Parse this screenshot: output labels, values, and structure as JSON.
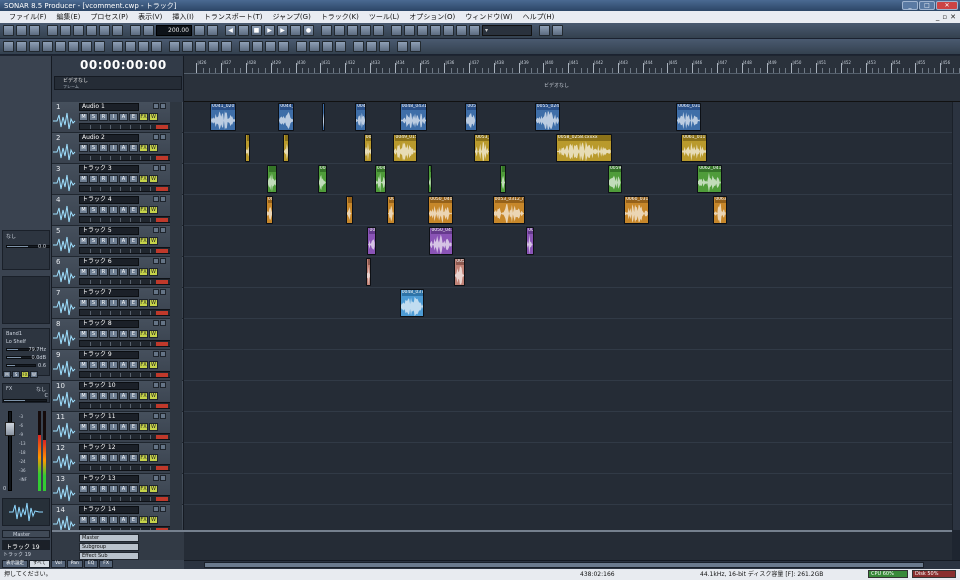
{
  "window": {
    "title": "SONAR 8.5 Producer - [vcomment.cwp - トラック]"
  },
  "menu": [
    "ファイル(F)",
    "編集(E)",
    "プロセス(P)",
    "表示(V)",
    "挿入(I)",
    "トランスポート(T)",
    "ジャンプ(G)",
    "トラック(K)",
    "ツール(L)",
    "オプション(O)",
    "ウィンドウ(W)",
    "ヘルプ(H)"
  ],
  "toolbar": {
    "tempo": "200.00"
  },
  "clock": {
    "time": "00:00:00:00"
  },
  "video": {
    "title": "ビデオなし",
    "fps": "フレーム",
    "cue": "ビデオなし"
  },
  "ruler": {
    "labels": [
      "|426",
      "|427",
      "|428",
      "|429",
      "|430",
      "|431",
      "|432",
      "|433",
      "|434",
      "|435",
      "|436",
      "|437",
      "|438",
      "|439",
      "|440",
      "|441",
      "|442",
      "|443",
      "|444",
      "|445",
      "|446",
      "|447",
      "|448",
      "|449",
      "|450",
      "|451",
      "|452",
      "|453",
      "|454",
      "|455",
      "|456"
    ]
  },
  "inspector": {
    "none_label": "なし",
    "gain": "0.0",
    "eq_band": "Band1",
    "eq_type": "Lo Shelf",
    "freq": "79.7Hz",
    "eq_gain": "0.0dB",
    "q": "0.6",
    "fx": "FX",
    "fx_val": "なし",
    "pan": "C",
    "vol": "0",
    "scale": [
      "-3",
      "-6",
      "-9",
      "-13",
      "-18",
      "-24",
      "-36",
      "-INF"
    ],
    "out": "Master",
    "track": "トラック 19",
    "track_sub": "トラック 19"
  },
  "track_buttons": [
    "M",
    "S",
    "R",
    "I",
    "A",
    "E",
    "FX",
    "W"
  ],
  "tracks": [
    {
      "num": "1",
      "name": "Audio 1"
    },
    {
      "num": "2",
      "name": "Audio 2"
    },
    {
      "num": "3",
      "name": "トラック 3"
    },
    {
      "num": "4",
      "name": "トラック 4"
    },
    {
      "num": "5",
      "name": "トラック 5"
    },
    {
      "num": "6",
      "name": "トラック 6"
    },
    {
      "num": "7",
      "name": "トラック 7"
    },
    {
      "num": "8",
      "name": "トラック 8"
    },
    {
      "num": "9",
      "name": "トラック 9"
    },
    {
      "num": "10",
      "name": "トラック 10"
    },
    {
      "num": "11",
      "name": "トラック 11"
    },
    {
      "num": "12",
      "name": "トラック 12"
    },
    {
      "num": "13",
      "name": "トラック 13"
    },
    {
      "num": "14",
      "name": "トラック 14"
    }
  ],
  "clips": [
    {
      "track": 0,
      "color": "c0",
      "label": "0041_0201.co",
      "start": 426.55,
      "end": 427.6
    },
    {
      "track": 0,
      "color": "c0",
      "label": "0044_02",
      "start": 429.3,
      "end": 429.95
    },
    {
      "track": 0,
      "color": "c0",
      "label": "",
      "start": 431.05,
      "end": 431.15
    },
    {
      "track": 0,
      "color": "c0",
      "label": "0047",
      "start": 432.4,
      "end": 432.85
    },
    {
      "track": 0,
      "color": "c0",
      "label": "0048_0431_c",
      "start": 434.2,
      "end": 435.3
    },
    {
      "track": 0,
      "color": "c0",
      "label": "0052",
      "start": 436.85,
      "end": 437.3
    },
    {
      "track": 0,
      "color": "c0",
      "label": "0055_0248_c",
      "start": 439.65,
      "end": 440.65
    },
    {
      "track": 0,
      "color": "c0",
      "label": "0060_0311_c",
      "start": 445.35,
      "end": 446.35
    },
    {
      "track": 1,
      "color": "c1",
      "label": "",
      "start": 427.95,
      "end": 428.15
    },
    {
      "track": 1,
      "color": "c1",
      "label": "",
      "start": 429.5,
      "end": 429.75
    },
    {
      "track": 1,
      "color": "c1",
      "label": "0048",
      "start": 432.75,
      "end": 433.1
    },
    {
      "track": 1,
      "color": "c1",
      "label": "0049_0158",
      "start": 433.95,
      "end": 434.9
    },
    {
      "track": 1,
      "color": "c1",
      "label": "0053_0",
      "start": 437.2,
      "end": 437.85
    },
    {
      "track": 1,
      "color": "c1",
      "label": "0058_0258.cxxxx",
      "start": 440.5,
      "end": 442.75
    },
    {
      "track": 1,
      "color": "c1",
      "label": "0061_0117_co",
      "start": 445.55,
      "end": 446.6
    },
    {
      "track": 2,
      "color": "c2",
      "label": "",
      "start": 428.85,
      "end": 429.25
    },
    {
      "track": 2,
      "color": "c2",
      "label": "0046",
      "start": 430.9,
      "end": 431.25
    },
    {
      "track": 2,
      "color": "c2",
      "label": "0049",
      "start": 433.2,
      "end": 433.65
    },
    {
      "track": 2,
      "color": "c2",
      "label": "",
      "start": 435.35,
      "end": 435.5
    },
    {
      "track": 2,
      "color": "c2",
      "label": "",
      "start": 438.25,
      "end": 438.5
    },
    {
      "track": 2,
      "color": "c2",
      "label": "0059_0",
      "start": 442.6,
      "end": 443.15
    },
    {
      "track": 2,
      "color": "c2",
      "label": "0062_0412_ro",
      "start": 446.2,
      "end": 447.2
    },
    {
      "track": 3,
      "color": "c3",
      "label": "0043",
      "start": 428.8,
      "end": 429.1
    },
    {
      "track": 3,
      "color": "c3",
      "label": "",
      "start": 432.05,
      "end": 432.3
    },
    {
      "track": 3,
      "color": "c3",
      "label": "0050",
      "start": 433.7,
      "end": 434.0
    },
    {
      "track": 3,
      "color": "c3",
      "label": "0050_0407_c",
      "start": 435.35,
      "end": 436.35
    },
    {
      "track": 3,
      "color": "c3",
      "label": "0053_0312_ro",
      "start": 437.95,
      "end": 439.25
    },
    {
      "track": 3,
      "color": "c3",
      "label": "0060_0318_c",
      "start": 443.25,
      "end": 444.25
    },
    {
      "track": 3,
      "color": "c3",
      "label": "0063",
      "start": 446.85,
      "end": 447.4
    },
    {
      "track": 4,
      "color": "c4",
      "label": "0046",
      "start": 432.9,
      "end": 433.25
    },
    {
      "track": 4,
      "color": "c4",
      "label": "0050_0418_c",
      "start": 435.4,
      "end": 436.35
    },
    {
      "track": 4,
      "color": "c4",
      "label": "0055",
      "start": 439.3,
      "end": 439.6
    },
    {
      "track": 5,
      "color": "c5",
      "label": "",
      "start": 432.85,
      "end": 433.05
    },
    {
      "track": 5,
      "color": "c5",
      "label": "0052",
      "start": 436.4,
      "end": 436.85
    },
    {
      "track": 6,
      "color": "c6",
      "label": "0048_0374_c",
      "start": 434.2,
      "end": 435.2
    }
  ],
  "buses": [
    "Master",
    "Subgroup",
    "Effect Sub"
  ],
  "bottom_tabs": [
    "表示設定",
    "すべて",
    "Vol",
    "Pan",
    "EQ",
    "FX"
  ],
  "status": {
    "hint": "押してください。",
    "position": "438:02:166",
    "format": "44.1kHz, 16-bit ディスク容量 [F]: 261.2GB",
    "cpu": "CPU 60%",
    "disk": "Disk 50%"
  }
}
